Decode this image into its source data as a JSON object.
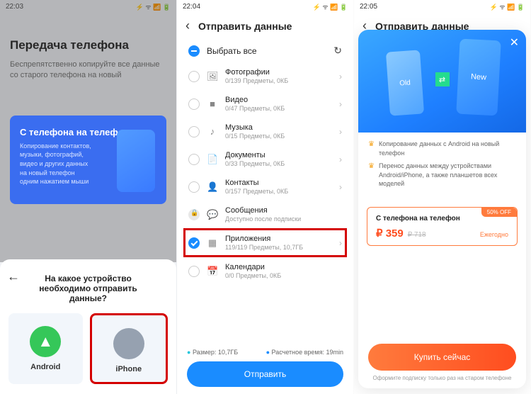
{
  "s1": {
    "time": "22:03",
    "status_icons": "⚡ ᯤ 📶 🔋",
    "page_title": "Передача телефона",
    "page_subtitle": "Беспрепятственно копируйте все данные со старого телефона на новый",
    "card_title": "С телефона на телефон",
    "card_text": "Копирование контактов, музыки, фотографий, видео и других данных на новый телефон одним нажатием мыши",
    "sheet_question": "На какое устройство необходимо отправить данные?",
    "device_android": "Android",
    "device_iphone": "iPhone"
  },
  "s2": {
    "time": "22:04",
    "status_icons": "⚡ ᯤ 📶 🔋",
    "header": "Отправить данные",
    "select_all": "Выбрать все",
    "items": [
      {
        "title": "Фотографии",
        "sub": "0/139 Предметы, 0КБ",
        "icon": "🖼"
      },
      {
        "title": "Видео",
        "sub": "0/47 Предметы, 0КБ",
        "icon": "■"
      },
      {
        "title": "Музыка",
        "sub": "0/15 Предметы, 0КБ",
        "icon": "♪"
      },
      {
        "title": "Документы",
        "sub": "0/33 Предметы, 0КБ",
        "icon": "📄"
      },
      {
        "title": "Контакты",
        "sub": "0/157 Предметы, 0КБ",
        "icon": "👤"
      },
      {
        "title": "Сообщения",
        "sub": "Доступно после подписки",
        "icon": "💬"
      },
      {
        "title": "Приложения",
        "sub": "119/119 Предметы, 10,7ГБ",
        "icon": "▦"
      },
      {
        "title": "Календари",
        "sub": "0/0 Предметы, 0КБ",
        "icon": "📅"
      }
    ],
    "size_label": "Размер: 10,7ГБ",
    "time_label": "Расчетное время: 19min",
    "send": "Отправить"
  },
  "s3": {
    "time": "22:05",
    "status_icons": "⚡ ᯤ 📶 🔋",
    "header": "Отправить данные",
    "hero_old": "Old",
    "hero_new": "New",
    "feat1": "Копирование данных с Android на новый телефон",
    "feat2": "Перенос данных между устройствами Android/iPhone, а также планшетов всех моделей",
    "badge": "50% OFF",
    "price_title": "С телефона на телефон",
    "price_currency": "₽ 359",
    "price_old": "₽ 718",
    "price_period": "Ежегодно",
    "buy": "Купить сейчас",
    "note": "Оформите подписку только раз на старом телефоне"
  }
}
